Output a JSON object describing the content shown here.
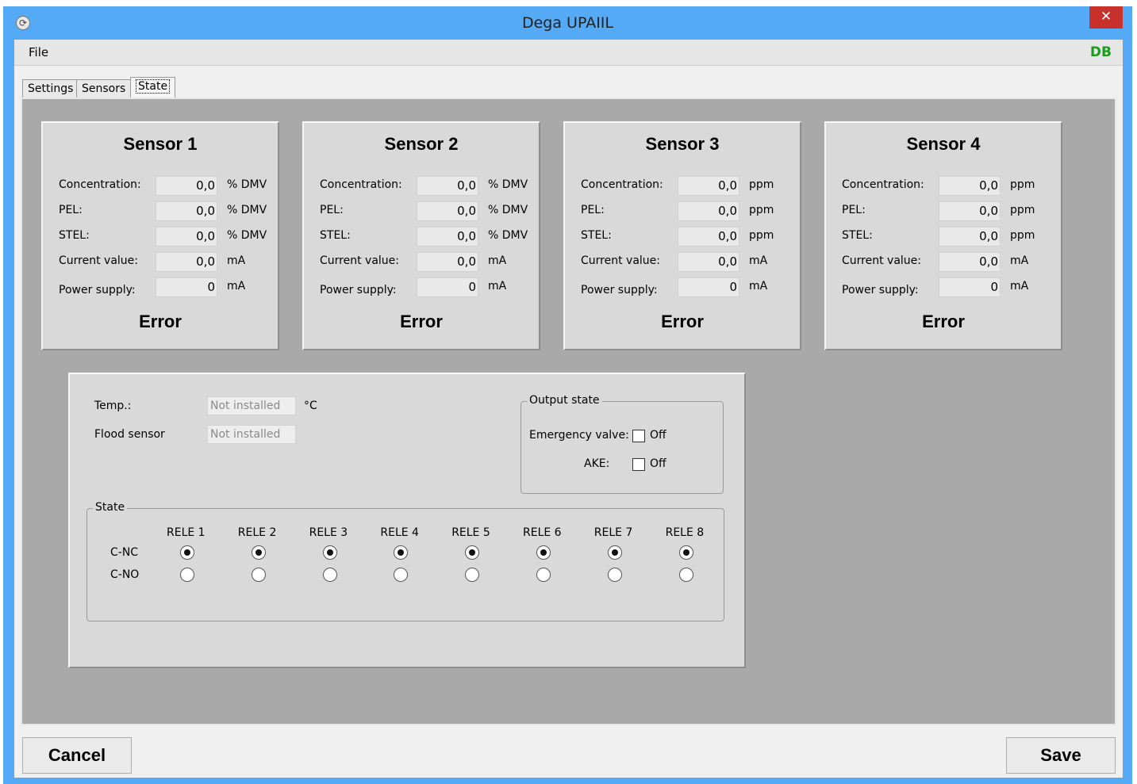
{
  "window": {
    "title": "Dega UPAIIL",
    "close_glyph": "✕",
    "app_icon": "refresh-icon"
  },
  "menu": {
    "file": "File",
    "db_indicator": "DB",
    "db_color": "#1e9a1e"
  },
  "tabs": [
    "Settings",
    "Sensors",
    "State"
  ],
  "active_tab": "State",
  "sensors": [
    {
      "title": "Sensor 1",
      "concentration": "0,0",
      "pel": "0,0",
      "stel": "0,0",
      "current": "0,0",
      "power": "0",
      "gas_unit": "% DMV",
      "current_unit": "mA",
      "power_unit": "mA",
      "status": "Error"
    },
    {
      "title": "Sensor 2",
      "concentration": "0,0",
      "pel": "0,0",
      "stel": "0,0",
      "current": "0,0",
      "power": "0",
      "gas_unit": "% DMV",
      "current_unit": "mA",
      "power_unit": "mA",
      "status": "Error"
    },
    {
      "title": "Sensor 3",
      "concentration": "0,0",
      "pel": "0,0",
      "stel": "0,0",
      "current": "0,0",
      "power": "0",
      "gas_unit": "ppm",
      "current_unit": "mA",
      "power_unit": "mA",
      "status": "Error"
    },
    {
      "title": "Sensor 4",
      "concentration": "0,0",
      "pel": "0,0",
      "stel": "0,0",
      "current": "0,0",
      "power": "0",
      "gas_unit": "ppm",
      "current_unit": "mA",
      "power_unit": "mA",
      "status": "Error"
    }
  ],
  "labels": {
    "concentration": "Concentration:",
    "pel": "PEL:",
    "stel": "STEL:",
    "current": "Current value:",
    "power": "Power supply:"
  },
  "environment": {
    "temp_label": "Temp.:",
    "temp_value": "Not installed",
    "temp_unit": "°C",
    "flood_label": "Flood sensor",
    "flood_value": "Not installed"
  },
  "output_state": {
    "title": "Output state",
    "emergency_label": "Emergency valve:",
    "emergency_value": "Off",
    "emergency_checked": false,
    "ake_label": "AKE:",
    "ake_value": "Off",
    "ake_checked": false
  },
  "relay_state": {
    "title": "State",
    "row_labels": [
      "C-NC",
      "C-NO"
    ],
    "relays": [
      {
        "name": "RELE 1",
        "selected": "C-NC"
      },
      {
        "name": "RELE 2",
        "selected": "C-NC"
      },
      {
        "name": "RELE 3",
        "selected": "C-NC"
      },
      {
        "name": "RELE 4",
        "selected": "C-NC"
      },
      {
        "name": "RELE 5",
        "selected": "C-NC"
      },
      {
        "name": "RELE 6",
        "selected": "C-NC"
      },
      {
        "name": "RELE 7",
        "selected": "C-NC"
      },
      {
        "name": "RELE 8",
        "selected": "C-NC"
      }
    ]
  },
  "buttons": {
    "cancel": "Cancel",
    "save": "Save"
  }
}
